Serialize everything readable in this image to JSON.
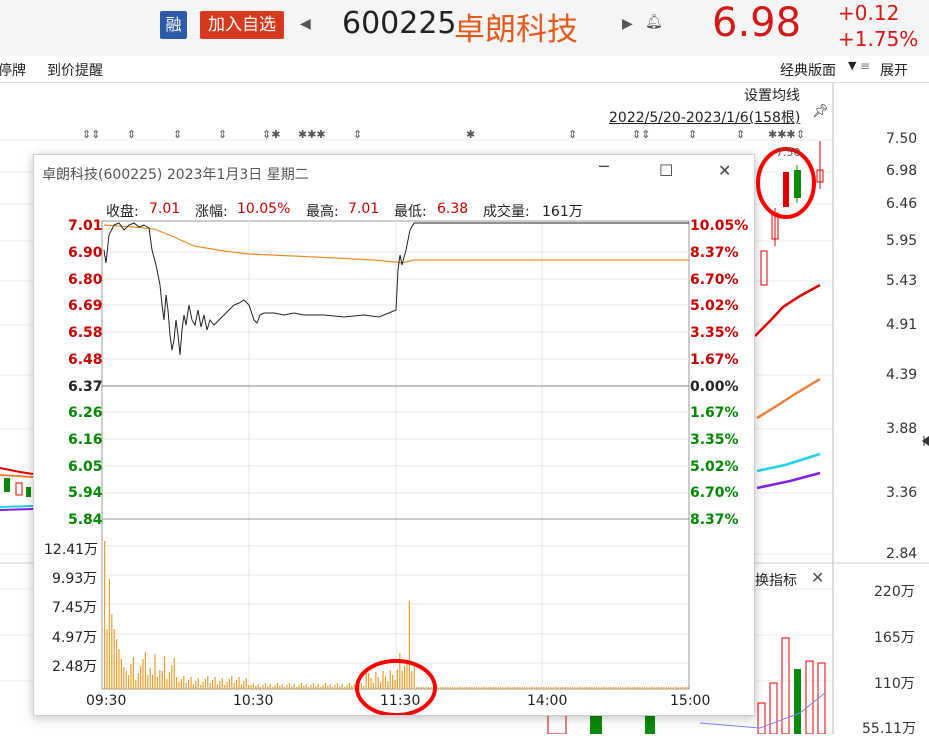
{
  "header": {
    "rong_label": "融",
    "add_watch_label": "加入自选",
    "code": "600225",
    "name": "卓朗科技",
    "price": "6.98",
    "change": "+0.12",
    "change_pct": "+1.75%"
  },
  "toolbar": {
    "suspend_label": "停牌",
    "price_alert_label": "到价提醒",
    "layout_label": "经典版面",
    "expand_label": "展开"
  },
  "kline": {
    "set_ma_label": "设置均线",
    "date_range": "2022/5/20-2023/1/6(158根)",
    "high_marker": "7.50",
    "price_axis": [
      "7.50",
      "6.98",
      "6.46",
      "5.95",
      "5.43",
      "4.91",
      "4.39",
      "3.88",
      "3.36",
      "2.84"
    ],
    "vol_axis": [
      "220万",
      "165万",
      "110万",
      "55.11万"
    ],
    "indicator_label": "换指标",
    "colors": {
      "ma_red": "#e00000",
      "ma_orange": "#f08040",
      "ma_cyan": "#22d0e8",
      "ma_purple": "#8020e0",
      "candle_up": "#e00000",
      "candle_down": "#0a8a0a"
    }
  },
  "dialog": {
    "title": "卓朗科技(600225)  2023年1月3日  星期二",
    "close_label": "收盘:",
    "close_value": "7.01",
    "change_label": "涨幅:",
    "change_value": "10.05%",
    "high_label": "最高:",
    "high_value": "7.01",
    "low_label": "最低:",
    "low_value": "6.38",
    "volume_label": "成交量:",
    "volume_value": "161万",
    "price_labels": [
      "7.01",
      "6.90",
      "6.80",
      "6.69",
      "6.58",
      "6.48",
      "6.37",
      "6.26",
      "6.16",
      "6.05",
      "5.94",
      "5.84"
    ],
    "pct_labels": [
      "10.05%",
      "8.37%",
      "6.70%",
      "5.02%",
      "3.35%",
      "1.67%",
      "0.00%",
      "1.67%",
      "3.35%",
      "5.02%",
      "6.70%",
      "8.37%"
    ],
    "vol_labels": [
      "12.41万",
      "9.93万",
      "7.45万",
      "4.97万",
      "2.48万"
    ],
    "time_labels": [
      "09:30",
      "10:30",
      "11:30",
      "14:00",
      "15:00"
    ],
    "colors": {
      "up": "#cc0000",
      "down": "#008800",
      "flat": "#222222",
      "avg_line": "#e8902a",
      "price_line": "#222222",
      "volume": "#e8a030",
      "highlight": "#ff0000"
    }
  }
}
